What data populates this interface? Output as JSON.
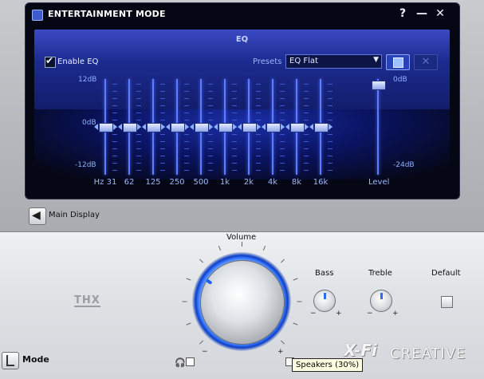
{
  "window": {
    "title": "ENTERTAINMENT MODE",
    "help_label": "?",
    "minimize_label": "—",
    "close_label": "✕"
  },
  "eq": {
    "header": "EQ",
    "enable_label": "Enable EQ",
    "enable_checked": true,
    "check_glyph": "✔",
    "presets_label": "Presets",
    "preset_value": "EQ Flat",
    "dropdown_arrow": "▼",
    "delete_glyph": "✕",
    "scale": {
      "top": "12dB",
      "mid": "0dB",
      "bottom": "-12dB"
    },
    "bands": [
      {
        "label": "Hz 31",
        "value_db": 0
      },
      {
        "label": "62",
        "value_db": 0
      },
      {
        "label": "125",
        "value_db": 0
      },
      {
        "label": "250",
        "value_db": 0
      },
      {
        "label": "500",
        "value_db": 0
      },
      {
        "label": "1k",
        "value_db": 0
      },
      {
        "label": "2k",
        "value_db": 0
      },
      {
        "label": "4k",
        "value_db": 0
      },
      {
        "label": "8k",
        "value_db": 0
      },
      {
        "label": "16k",
        "value_db": 0
      }
    ],
    "level": {
      "label": "Level",
      "top": "0dB",
      "bottom": "-24dB",
      "value_db": 0
    }
  },
  "nav": {
    "main_display_label": "Main Display",
    "back_glyph": "◀"
  },
  "controls": {
    "volume_label": "Volume",
    "volume_minus": "−",
    "volume_plus": "+",
    "bass_label": "Bass",
    "treble_label": "Treble",
    "default_label": "Default",
    "minus": "−",
    "plus": "+"
  },
  "logos": {
    "thx": "THX",
    "xfi": "X-Fi",
    "creative": "CREATIVE"
  },
  "mode": {
    "label": "Mode"
  },
  "headphone_glyph": "🎧",
  "tooltip": "Speakers (30%)",
  "colors": {
    "accent": "#3b7bff",
    "panel_bg": "#050714",
    "eq_blue": "#1c2b8f"
  }
}
